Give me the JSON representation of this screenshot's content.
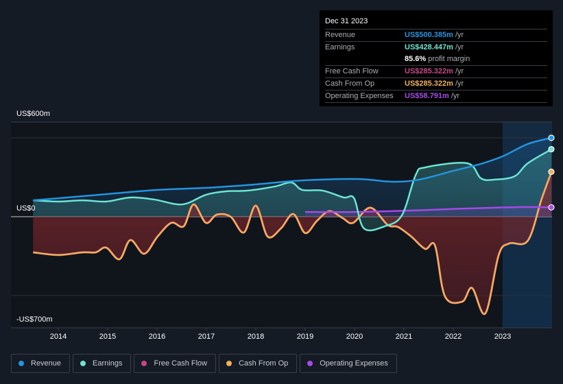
{
  "tooltip": {
    "date": "Dec 31 2023",
    "rows": [
      {
        "label": "Revenue",
        "value": "US$500.385m",
        "unit": "/yr",
        "color": "#2394df"
      },
      {
        "label": "Earnings",
        "value": "US$428.447m",
        "unit": "/yr",
        "color": "#6ce5d4"
      },
      {
        "label": "",
        "value": "85.6%",
        "unit": "profit margin",
        "color": "#ffffff"
      },
      {
        "label": "Free Cash Flow",
        "value": "US$285.322m",
        "unit": "/yr",
        "color": "#c5468a"
      },
      {
        "label": "Cash From Op",
        "value": "US$285.322m",
        "unit": "/yr",
        "color": "#f0b05a"
      },
      {
        "label": "Operating Expenses",
        "value": "US$58.791m",
        "unit": "/yr",
        "color": "#a54ae8"
      }
    ]
  },
  "chart_data": {
    "type": "area",
    "title": "",
    "xlabel": "",
    "ylabel": "",
    "ylim": [
      -700,
      600
    ],
    "xlim": [
      2013.5,
      2024.0
    ],
    "y_tick_labels": [
      "US$600m",
      "US$0",
      "-US$700m"
    ],
    "y_gridlines": [
      500,
      0,
      -500
    ],
    "x_ticks": [
      2014,
      2015,
      2016,
      2017,
      2018,
      2019,
      2020,
      2021,
      2022,
      2023
    ],
    "x_tick_labels": [
      "2014",
      "2015",
      "2016",
      "2017",
      "2018",
      "2019",
      "2020",
      "2021",
      "2022",
      "2023"
    ],
    "highlight_from": 2023.0,
    "legend_position": "bottom-left",
    "grid": true,
    "series": [
      {
        "name": "Revenue",
        "color": "#2394df",
        "x": [
          2013.49,
          2014.0,
          2014.97,
          2016.01,
          2016.99,
          2017.96,
          2018.94,
          2020.06,
          2020.75,
          2021.31,
          2022.0,
          2022.56,
          2023.0,
          2023.51,
          2023.99
        ],
        "values": [
          104,
          117,
          143,
          170,
          183,
          204,
          230,
          239,
          222,
          235,
          291,
          335,
          383,
          461,
          500
        ]
      },
      {
        "name": "Earnings",
        "color": "#6ce5d4",
        "x": [
          2013.49,
          2014.0,
          2014.49,
          2014.97,
          2015.46,
          2015.94,
          2016.51,
          2016.99,
          2017.4,
          2017.82,
          2018.38,
          2018.72,
          2018.94,
          2019.36,
          2019.78,
          2019.99,
          2020.19,
          2020.61,
          2020.96,
          2021.24,
          2021.44,
          2022.28,
          2022.56,
          2022.83,
          2023.24,
          2023.51,
          2023.99
        ],
        "values": [
          104,
          96,
          104,
          96,
          122,
          109,
          78,
          139,
          161,
          165,
          191,
          217,
          170,
          165,
          122,
          117,
          -74,
          -61,
          9,
          265,
          313,
          339,
          243,
          235,
          256,
          339,
          428
        ]
      },
      {
        "name": "Free Cash Flow",
        "color": "#c5468a",
        "x": [
          2013.49,
          2014.0,
          2014.49,
          2014.76,
          2014.97,
          2015.24,
          2015.46,
          2015.74,
          2016.01,
          2016.29,
          2016.54,
          2016.74,
          2016.99,
          2017.21,
          2017.49,
          2017.76,
          2018.0,
          2018.24,
          2018.51,
          2018.76,
          2019.0,
          2019.24,
          2019.49,
          2019.76,
          2019.97,
          2020.32,
          2020.67,
          2020.88,
          2021.15,
          2021.43,
          2021.63,
          2021.83,
          2022.18,
          2022.38,
          2022.65,
          2022.92,
          2023.13,
          2023.51,
          2023.79,
          2023.99
        ],
        "values": [
          -226,
          -243,
          -226,
          -226,
          -196,
          -270,
          -148,
          -235,
          -126,
          -39,
          -61,
          78,
          -39,
          13,
          0,
          -100,
          70,
          -126,
          -74,
          17,
          -104,
          -26,
          35,
          -9,
          -39,
          57,
          -52,
          -65,
          -126,
          -204,
          -183,
          -504,
          -539,
          -452,
          -613,
          -243,
          -170,
          -152,
          113,
          285
        ]
      },
      {
        "name": "Cash From Op",
        "color": "#f0b05a",
        "x": [
          2013.49,
          2014.0,
          2014.49,
          2014.76,
          2014.97,
          2015.24,
          2015.46,
          2015.74,
          2016.01,
          2016.29,
          2016.54,
          2016.74,
          2016.99,
          2017.21,
          2017.49,
          2017.76,
          2018.0,
          2018.24,
          2018.51,
          2018.76,
          2019.0,
          2019.24,
          2019.49,
          2019.76,
          2019.97,
          2020.32,
          2020.67,
          2020.88,
          2021.15,
          2021.43,
          2021.63,
          2021.83,
          2022.18,
          2022.38,
          2022.65,
          2022.92,
          2023.13,
          2023.51,
          2023.79,
          2023.99
        ],
        "values": [
          -226,
          -243,
          -226,
          -226,
          -196,
          -270,
          -148,
          -235,
          -126,
          -39,
          -61,
          78,
          -39,
          13,
          0,
          -100,
          70,
          -126,
          -74,
          17,
          -104,
          -26,
          35,
          -9,
          -39,
          57,
          -52,
          -65,
          -126,
          -204,
          -183,
          -504,
          -539,
          -452,
          -613,
          -243,
          -170,
          -152,
          113,
          285
        ]
      },
      {
        "name": "Operating Expenses",
        "color": "#a54ae8",
        "x": [
          2019.0,
          2020.04,
          2021.15,
          2022.28,
          2023.38,
          2023.99
        ],
        "values": [
          30,
          30,
          39,
          52,
          61,
          59
        ]
      }
    ]
  },
  "legend": [
    {
      "label": "Revenue",
      "color": "#2394df"
    },
    {
      "label": "Earnings",
      "color": "#6ce5d4"
    },
    {
      "label": "Free Cash Flow",
      "color": "#c5468a"
    },
    {
      "label": "Cash From Op",
      "color": "#f0b05a"
    },
    {
      "label": "Operating Expenses",
      "color": "#a54ae8"
    }
  ]
}
